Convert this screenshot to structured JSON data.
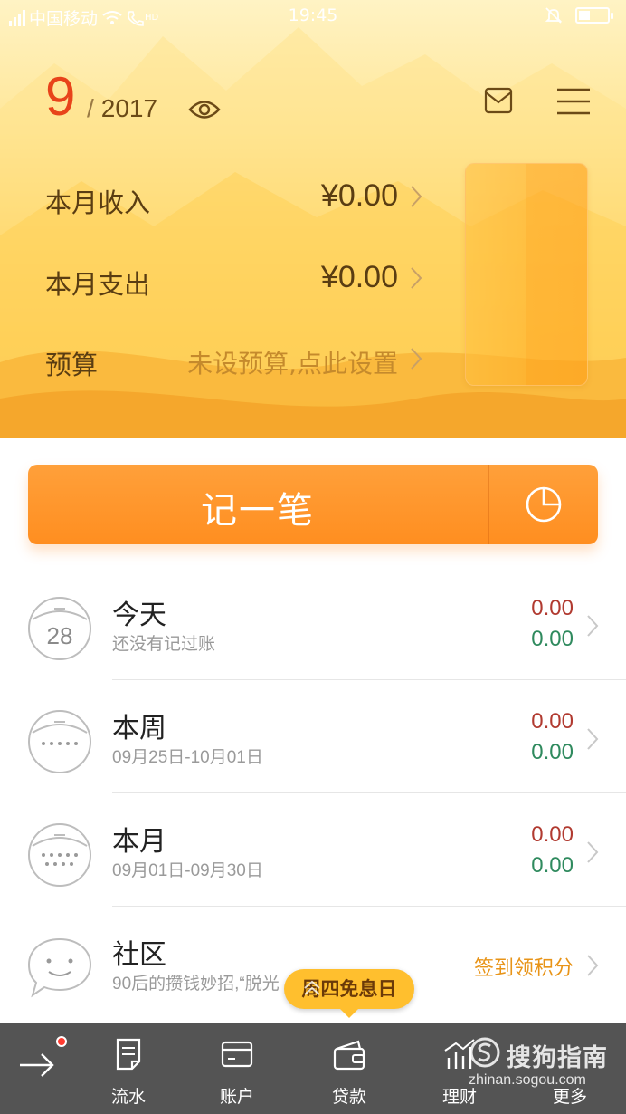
{
  "status_bar": {
    "carrier": "中国移动",
    "network_badge": "HD",
    "time": "19:45",
    "icons": [
      "signal-icon",
      "wifi-icon",
      "call-icon",
      "alarm-muted-icon",
      "battery-icon"
    ]
  },
  "header": {
    "month": "9",
    "year": "2017",
    "slash": "/",
    "rows": [
      {
        "label": "本月收入",
        "value": "¥0.00"
      },
      {
        "label": "本月支出",
        "value": "¥0.00"
      },
      {
        "label": "预算",
        "hint": "未设预算,点此设置"
      }
    ],
    "colors": {
      "month": "#e8431a",
      "text": "#5a3d12",
      "hint": "#c58a2c"
    }
  },
  "record_button": {
    "label": "记一笔",
    "accent": "#ff8e20"
  },
  "list": [
    {
      "title": "今天",
      "subtitle": "还没有记过账",
      "income": "0.00",
      "expense": "0.00",
      "icon_day": "28"
    },
    {
      "title": "本周",
      "subtitle": "09月25日-10月01日",
      "income": "0.00",
      "expense": "0.00"
    },
    {
      "title": "本月",
      "subtitle": "09月01日-09月30日",
      "income": "0.00",
      "expense": "0.00"
    },
    {
      "title": "社区",
      "subtitle": "90后的攒钱妙招,“脱光",
      "action": "签到领积分"
    }
  ],
  "promo": {
    "label": "周四免息日"
  },
  "tabbar": {
    "tabs": [
      {
        "label": "流水",
        "icon": "receipt-icon"
      },
      {
        "label": "账户",
        "icon": "card-icon"
      },
      {
        "label": "贷款",
        "icon": "wallet-icon"
      },
      {
        "label": "理财",
        "icon": "chart-icon"
      },
      {
        "label": "更多",
        "icon": "more-icon"
      }
    ]
  },
  "watermark": {
    "brand": "搜狗指南",
    "url": "zhinan.sogou.com"
  }
}
